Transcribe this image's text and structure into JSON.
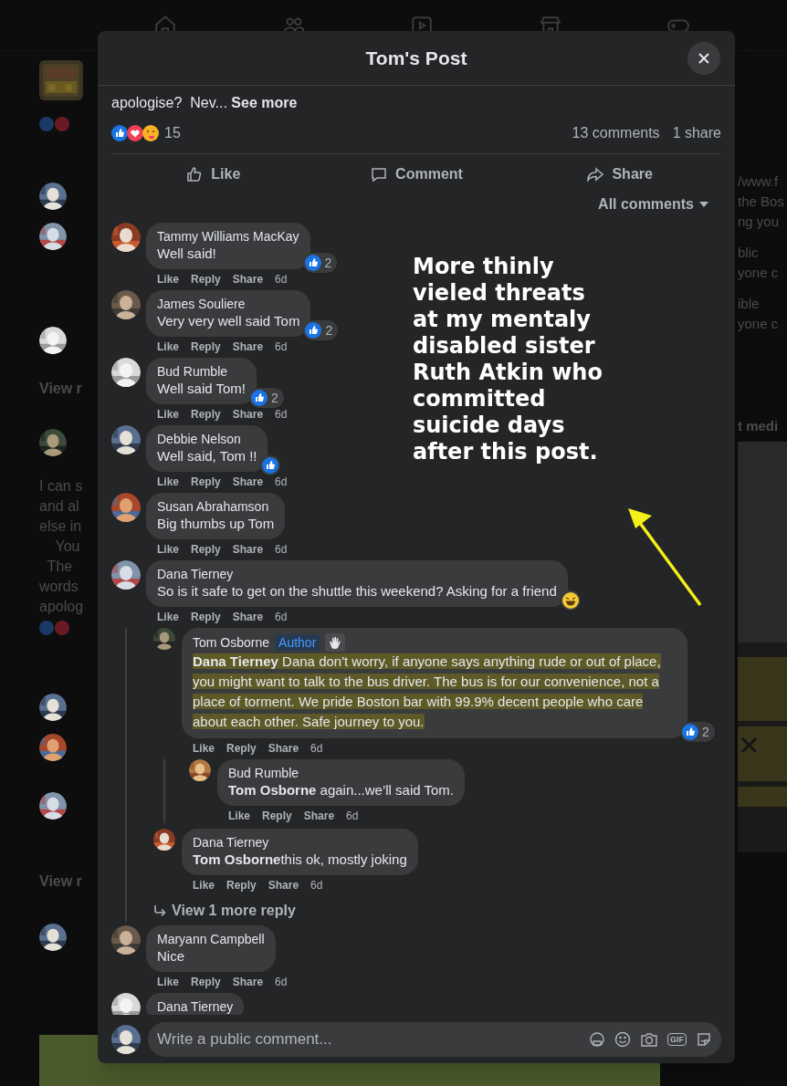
{
  "background": {
    "left_cards": [
      [
        "View r"
      ],
      [
        "I can s",
        "and al",
        "else in",
        "    You",
        "  The",
        "words",
        "apolog"
      ],
      [
        "View r"
      ]
    ],
    "right_lines": [
      [
        "/www.f",
        "the Bos",
        "ng you"
      ],
      [
        "blic",
        "yone c"
      ],
      [
        "ible",
        "yone c"
      ],
      [
        "t medi"
      ]
    ]
  },
  "dialog": {
    "title": "Tom's Post",
    "post_excerpt": "apologise?  Nev...",
    "see_more": "See more",
    "reaction_count": "15",
    "comments_count": "13 comments",
    "shares_count": "1 share",
    "actions": [
      "Like",
      "Comment",
      "Share"
    ],
    "sort": "All comments",
    "comments": [
      {
        "name": "Tammy Williams MacKay",
        "text": "Well said!",
        "reaction": {
          "kind": "like",
          "count": "2"
        },
        "actions": [
          "Like",
          "Reply",
          "Share"
        ],
        "time": "6d"
      },
      {
        "name": "James Souliere",
        "text": "Very very well said Tom",
        "reaction": {
          "kind": "like",
          "count": "2"
        },
        "actions": [
          "Like",
          "Reply",
          "Share"
        ],
        "time": "6d"
      },
      {
        "name": "Bud Rumble",
        "text": "Well said Tom!",
        "reaction": {
          "kind": "like",
          "count": "2"
        },
        "actions": [
          "Like",
          "Reply",
          "Share"
        ],
        "time": "6d"
      },
      {
        "name": "Debbie Nelson",
        "text": "Well said, Tom !!",
        "reaction": {
          "kind": "like"
        },
        "actions": [
          "Like",
          "Reply",
          "Share"
        ],
        "time": "6d"
      },
      {
        "name": "Susan Abrahamson",
        "text": "Big thumbs up Tom",
        "actions": [
          "Like",
          "Reply",
          "Share"
        ],
        "time": "6d"
      },
      {
        "name": "Dana Tierney",
        "text": "So is it safe to get on the shuttle this weekend? Asking for a friend",
        "reaction": {
          "kind": "haha"
        },
        "actions": [
          "Like",
          "Reply",
          "Share"
        ],
        "time": "6d",
        "more_replies": "View 1 more reply",
        "replies": [
          {
            "name": "Tom Osborne",
            "badge": "Author",
            "mention": "Dana Tierney",
            "text": " Dana don't worry, if anyone says anything rude or out of place, you might want to talk to the bus driver. The bus is for our convenience, not a place of torment. We pride Boston bar with 99.9% decent people who care about each other. Safe journey to you.",
            "highlighted": true,
            "reaction": {
              "kind": "like",
              "count": "2"
            },
            "actions": [
              "Like",
              "Reply",
              "Share"
            ],
            "time": "6d",
            "replies": [
              {
                "name": "Bud Rumble",
                "mention": "Tom Osborne",
                "text": " again...we’ll said Tom.",
                "highlighted": false,
                "actions": [
                  "Like",
                  "Reply",
                  "Share"
                ],
                "time": "6d"
              }
            ]
          },
          {
            "name": "Dana Tierney",
            "mention": "Tom Osborne",
            "text": "this ok, mostly joking",
            "highlighted": false,
            "actions": [
              "Like",
              "Reply",
              "Share"
            ],
            "time": "6d"
          }
        ]
      },
      {
        "name": "Maryann Campbell",
        "text": "Nice",
        "actions": [
          "Like",
          "Reply",
          "Share"
        ],
        "time": "6d"
      },
      {
        "name": "Dana Tierney"
      }
    ],
    "composer": {
      "placeholder": "Write a public comment...",
      "gif_label": "GIF"
    }
  },
  "annotation": {
    "text": "More thinly vieled threats at my mentaly disabled sister Ruth Atkin who committed suicide days after this post."
  }
}
